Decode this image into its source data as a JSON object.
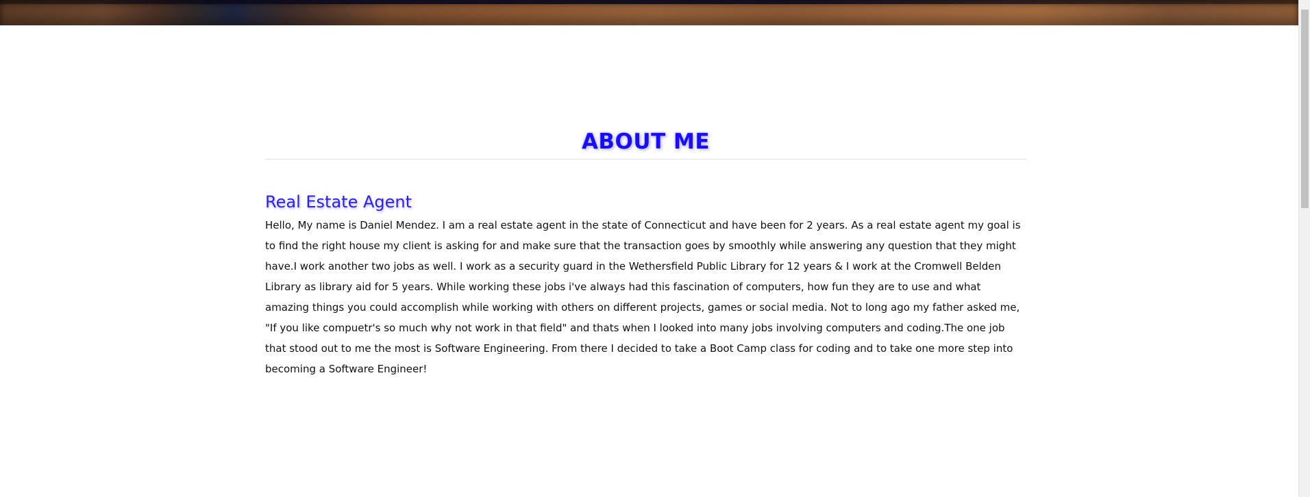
{
  "about": {
    "heading": "ABOUT ME",
    "subheading": "Real Estate Agent",
    "bio": "Hello, My name is Daniel Mendez. I am a real estate agent in the state of Connecticut and have been for 2 years. As a real estate agent my goal is to find the right house my client is asking for and make sure that the transaction goes by smoothly while answering any question that they might have.I work another two jobs as well. I work as a security guard in the Wethersfield Public Library for 12 years & I work at the Cromwell Belden Library as library aid for 5 years. While working these jobs i've always had this fascination of computers, how fun they are to use and what amazing things you could accomplish while working with others on different projects, games or social media. Not to long ago my father asked me, \"If you like compuetr's so much why not work in that field\" and thats when I looked into many jobs involving computers and coding.The one job that stood out to me the most is Software Engineering. From there I decided to take a Boot Camp class for coding and to take one more step into becoming a Software Engineer!"
  },
  "colors": {
    "heading": "#1a0dff",
    "subheading": "#2a1dff",
    "text": "#111111",
    "background": "#ffffff"
  }
}
